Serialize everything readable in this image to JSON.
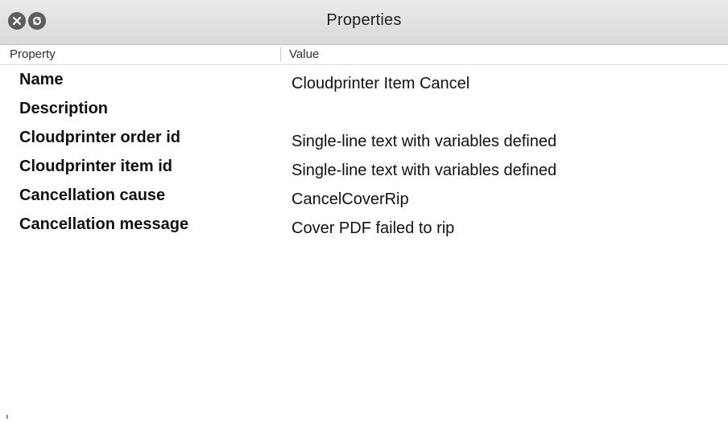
{
  "window": {
    "title": "Properties"
  },
  "columns": {
    "property": "Property",
    "value": "Value"
  },
  "rows": [
    {
      "property": "Name",
      "value": "Cloudprinter Item Cancel"
    },
    {
      "property": "Description",
      "value": ""
    },
    {
      "property": "Cloudprinter order id",
      "value": "Single-line text with variables defined"
    },
    {
      "property": "Cloudprinter item id",
      "value": "Single-line text with variables defined"
    },
    {
      "property": "Cancellation cause",
      "value": "CancelCoverRip"
    },
    {
      "property": "Cancellation message",
      "value": "Cover PDF failed to rip"
    }
  ],
  "icons": {
    "close": "close-icon",
    "restore": "restore-icon"
  }
}
